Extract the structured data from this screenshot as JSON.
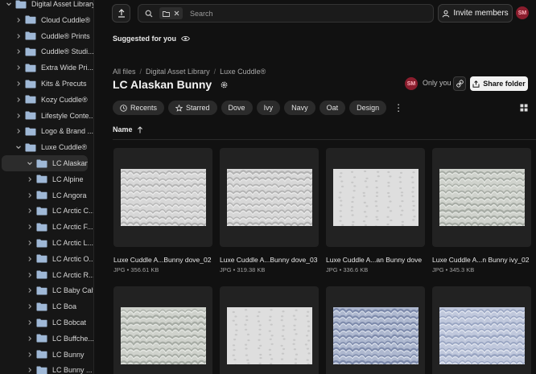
{
  "sidebar": {
    "items": [
      {
        "label": "Digital Asset Library",
        "level": 0,
        "expanded": true
      },
      {
        "label": "Cloud Cuddle®",
        "level": 1
      },
      {
        "label": "Cuddle® Prints",
        "level": 1
      },
      {
        "label": "Cuddle® Studi...",
        "level": 1
      },
      {
        "label": "Extra Wide Pri...",
        "level": 1
      },
      {
        "label": "Kits & Precuts",
        "level": 1
      },
      {
        "label": "Kozy Cuddle®",
        "level": 1
      },
      {
        "label": "Lifestyle Conte...",
        "level": 1
      },
      {
        "label": "Logo & Brand ...",
        "level": 1
      },
      {
        "label": "Luxe Cuddle®",
        "level": 1,
        "expanded": true
      },
      {
        "label": "LC Alaskan...",
        "level": 2,
        "expanded": true,
        "selected": true
      },
      {
        "label": "LC Alpine",
        "level": 2
      },
      {
        "label": "LC Angora",
        "level": 2
      },
      {
        "label": "LC Arctic C...",
        "level": 2
      },
      {
        "label": "LC Arctic F...",
        "level": 2
      },
      {
        "label": "LC Arctic L...",
        "level": 2
      },
      {
        "label": "LC Arctic O...",
        "level": 2
      },
      {
        "label": "LC Arctic R...",
        "level": 2
      },
      {
        "label": "LC Baby Calf",
        "level": 2
      },
      {
        "label": "LC Boa",
        "level": 2
      },
      {
        "label": "LC Bobcat",
        "level": 2
      },
      {
        "label": "LC Buffche...",
        "level": 2
      },
      {
        "label": "LC Bunny",
        "level": 2
      },
      {
        "label": "LC Bunny ...",
        "level": 2
      }
    ]
  },
  "topbar": {
    "search_placeholder": "Search",
    "invite_label": "Invite members",
    "avatar_initials": "SM"
  },
  "suggested": {
    "label": "Suggested for you"
  },
  "breadcrumb": [
    "All files",
    "Digital Asset Library",
    "Luxe Cuddle®"
  ],
  "folder": {
    "title": "LC Alaskan Bunny",
    "owner_initials": "SM",
    "sharing_label": "Only you",
    "share_button": "Share folder"
  },
  "filters": [
    "Recents",
    "Starred",
    "Dove",
    "Ivy",
    "Navy",
    "Oat",
    "Design"
  ],
  "sort": {
    "label": "Name"
  },
  "files": [
    {
      "name": "Luxe Cuddle A...Bunny dove_02",
      "meta": "JPG • 356.61 KB",
      "tone": "dove",
      "style": "waves"
    },
    {
      "name": "Luxe Cuddle A...Bunny dove_03",
      "meta": "JPG • 319.38 KB",
      "tone": "dove",
      "style": "waves"
    },
    {
      "name": "Luxe Cuddle A...an Bunny dove",
      "meta": "JPG • 336.6 KB",
      "tone": "light",
      "style": "stripes"
    },
    {
      "name": "Luxe Cuddle A...n Bunny ivy_02",
      "meta": "JPG • 345.3 KB",
      "tone": "ivy",
      "style": "waves"
    },
    {
      "name": "",
      "meta": "",
      "tone": "ivy",
      "style": "waves"
    },
    {
      "name": "",
      "meta": "",
      "tone": "light",
      "style": "stripes"
    },
    {
      "name": "",
      "meta": "",
      "tone": "navy",
      "style": "waves"
    },
    {
      "name": "",
      "meta": "",
      "tone": "navy2",
      "style": "waves"
    }
  ],
  "colors": {
    "background": "#111111",
    "sidebar": "#161616",
    "folder_icon": "#9fb8d6",
    "avatar_bg": "#8a1d2d"
  }
}
